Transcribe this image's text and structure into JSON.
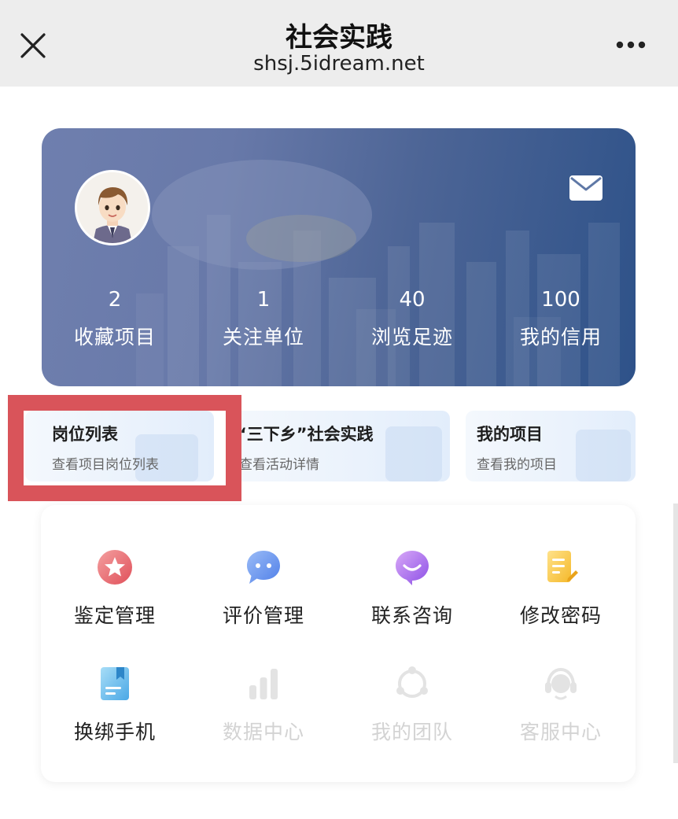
{
  "header": {
    "title": "社会实践",
    "subtitle": "shsj.5idream.net",
    "close_icon": "close-icon",
    "more_icon": "more-icon"
  },
  "profile": {
    "avatar_icon": "avatar",
    "mail_icon": "mail-icon",
    "stats": [
      {
        "value": "2",
        "label": "收藏项目"
      },
      {
        "value": "1",
        "label": "关注单位"
      },
      {
        "value": "40",
        "label": "浏览足迹"
      },
      {
        "value": "100",
        "label": "我的信用"
      }
    ]
  },
  "quick_cards": [
    {
      "title": "岗位列表",
      "subtitle": "查看项目岗位列表"
    },
    {
      "title": "“三下乡”社会实践",
      "subtitle": "查看活动详情"
    },
    {
      "title": "我的项目",
      "subtitle": "查看我的项目"
    }
  ],
  "highlight": {
    "color": "#d9545a"
  },
  "grid": {
    "items": [
      {
        "label": "鉴定管理",
        "icon": "star-badge-icon",
        "enabled": true
      },
      {
        "label": "评价管理",
        "icon": "chat-bubble-icon",
        "enabled": true
      },
      {
        "label": "联系咨询",
        "icon": "smile-bubble-icon",
        "enabled": true
      },
      {
        "label": "修改密码",
        "icon": "edit-document-icon",
        "enabled": true
      },
      {
        "label": "换绑手机",
        "icon": "bookmark-document-icon",
        "enabled": true
      },
      {
        "label": "数据中心",
        "icon": "bar-chart-icon",
        "enabled": false
      },
      {
        "label": "我的团队",
        "icon": "team-icon",
        "enabled": false
      },
      {
        "label": "客服中心",
        "icon": "headset-icon",
        "enabled": false
      }
    ]
  },
  "colors": {
    "topbar": "#ededed",
    "card_gradient_start": "#6f7fae",
    "card_gradient_end": "#2e5289",
    "disabled_text": "#d3d3d3"
  }
}
